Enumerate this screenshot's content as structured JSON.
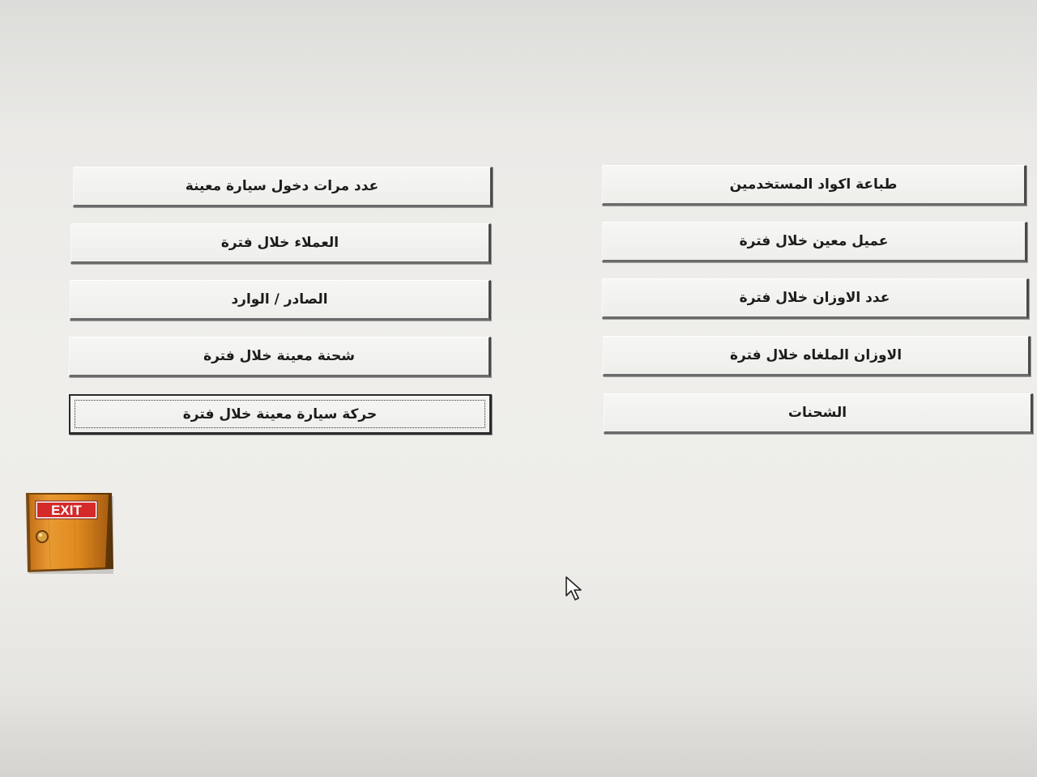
{
  "menu": {
    "left_column": [
      {
        "label": "عدد مرات دخول سيارة معينة"
      },
      {
        "label": "العملاء خلال فترة"
      },
      {
        "label": "الصادر / الوارد"
      },
      {
        "label": "شحنة معينة خلال فترة"
      },
      {
        "label": "حركة سيارة معينة خلال فترة"
      }
    ],
    "right_column": [
      {
        "label": "طباعة اكواد المستخدمين"
      },
      {
        "label": "عميل معين خلال فترة"
      },
      {
        "label": "عدد الاوزان خلال فترة"
      },
      {
        "label": "الاوزان الملغاه خلال فترة"
      },
      {
        "label": "الشحنات"
      }
    ]
  },
  "exit_button": {
    "label": "EXIT",
    "icon": "door-exit-icon",
    "door_color": "#e08a1e",
    "sign_color": "#d42a2a"
  },
  "colors": {
    "background": "#eeede9",
    "button_face": "#f2f2f0",
    "button_shadow": "#4a4a4a"
  }
}
